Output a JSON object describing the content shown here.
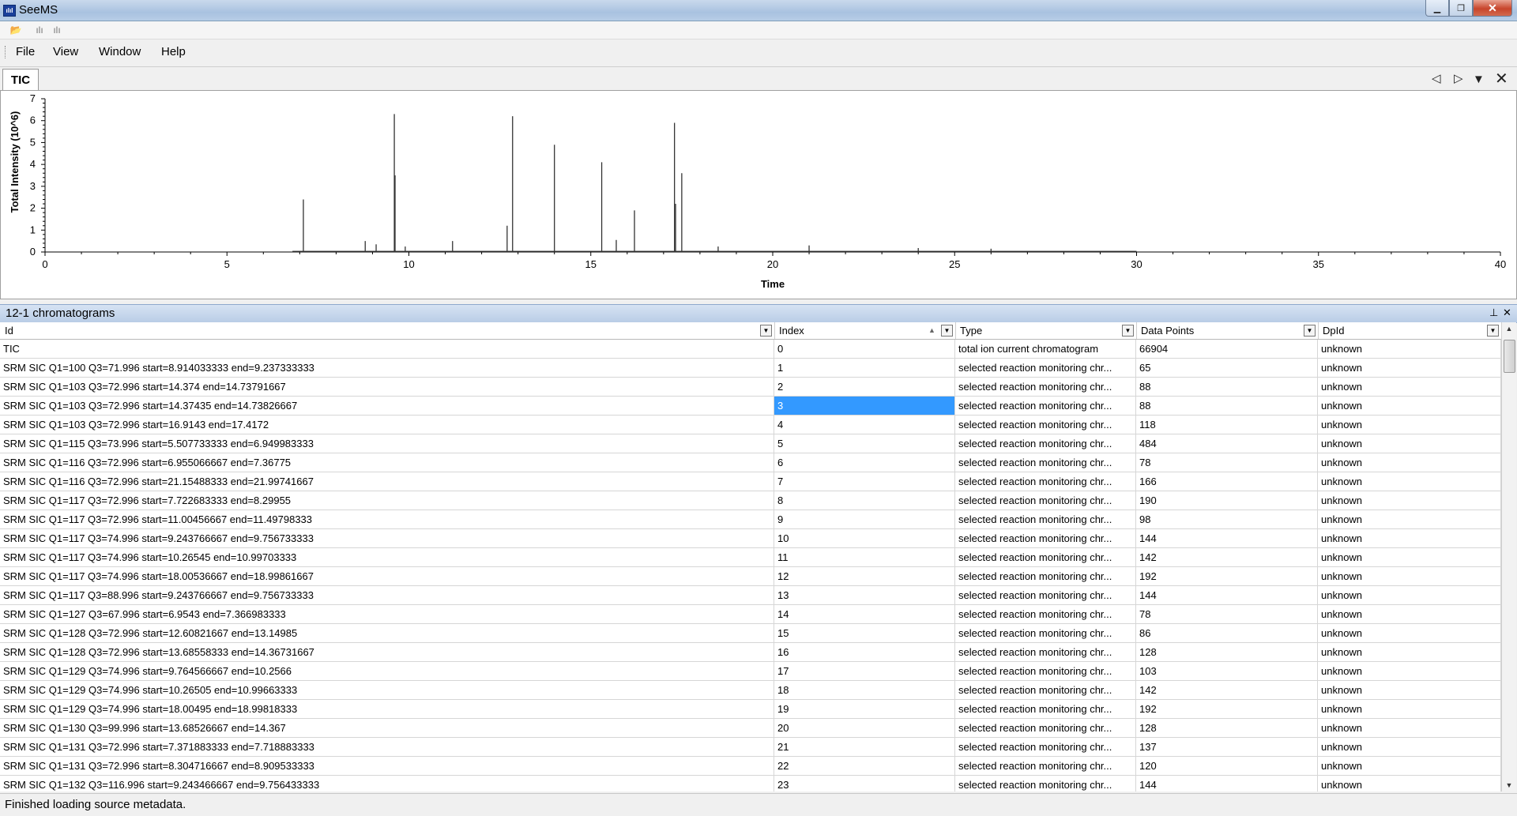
{
  "window": {
    "title": "SeeMS",
    "app_icon": "seems-app-icon"
  },
  "menu": [
    "File",
    "View",
    "Window",
    "Help"
  ],
  "tab": {
    "label": "TIC"
  },
  "chart_data": {
    "type": "line",
    "xlabel": "Time",
    "ylabel": "Total Intensity (10^6)",
    "xlim": [
      0,
      40
    ],
    "ylim": [
      0,
      7
    ],
    "x_ticks": [
      "0",
      "5",
      "10",
      "15",
      "20",
      "25",
      "30",
      "35",
      "40"
    ],
    "y_ticks": [
      "0",
      "1",
      "2",
      "3",
      "4",
      "5",
      "6",
      "7"
    ],
    "peaks": [
      {
        "x": 7.1,
        "y": 2.4
      },
      {
        "x": 8.8,
        "y": 0.5
      },
      {
        "x": 9.1,
        "y": 0.35
      },
      {
        "x": 9.6,
        "y": 6.3
      },
      {
        "x": 9.62,
        "y": 3.5
      },
      {
        "x": 9.9,
        "y": 0.25
      },
      {
        "x": 11.2,
        "y": 0.5
      },
      {
        "x": 12.7,
        "y": 1.2
      },
      {
        "x": 12.85,
        "y": 6.2
      },
      {
        "x": 14.0,
        "y": 4.9
      },
      {
        "x": 15.3,
        "y": 4.1
      },
      {
        "x": 15.7,
        "y": 0.55
      },
      {
        "x": 16.2,
        "y": 1.9
      },
      {
        "x": 17.3,
        "y": 5.9
      },
      {
        "x": 17.33,
        "y": 2.2
      },
      {
        "x": 17.5,
        "y": 3.6
      },
      {
        "x": 18.5,
        "y": 0.25
      },
      {
        "x": 21.0,
        "y": 0.3
      },
      {
        "x": 24.0,
        "y": 0.18
      },
      {
        "x": 26.0,
        "y": 0.15
      }
    ]
  },
  "grid": {
    "caption": "12-1 chromatograms",
    "columns": [
      "Id",
      "Index",
      "Type",
      "Data Points",
      "DpId"
    ],
    "rows": [
      [
        "TIC",
        "0",
        "total ion current chromatogram",
        "66904",
        "unknown"
      ],
      [
        "SRM SIC Q1=100 Q3=71.996 start=8.914033333 end=9.237333333",
        "1",
        "selected reaction monitoring chr...",
        "65",
        "unknown"
      ],
      [
        "SRM SIC Q1=103 Q3=72.996 start=14.374 end=14.73791667",
        "2",
        "selected reaction monitoring chr...",
        "88",
        "unknown"
      ],
      [
        "SRM SIC Q1=103 Q3=72.996 start=14.37435 end=14.73826667",
        "3",
        "selected reaction monitoring chr...",
        "88",
        "unknown"
      ],
      [
        "SRM SIC Q1=103 Q3=72.996 start=16.9143 end=17.4172",
        "4",
        "selected reaction monitoring chr...",
        "118",
        "unknown"
      ],
      [
        "SRM SIC Q1=115 Q3=73.996 start=5.507733333 end=6.949983333",
        "5",
        "selected reaction monitoring chr...",
        "484",
        "unknown"
      ],
      [
        "SRM SIC Q1=116 Q3=72.996 start=6.955066667 end=7.36775",
        "6",
        "selected reaction monitoring chr...",
        "78",
        "unknown"
      ],
      [
        "SRM SIC Q1=116 Q3=72.996 start=21.15488333 end=21.99741667",
        "7",
        "selected reaction monitoring chr...",
        "166",
        "unknown"
      ],
      [
        "SRM SIC Q1=117 Q3=72.996 start=7.722683333 end=8.29955",
        "8",
        "selected reaction monitoring chr...",
        "190",
        "unknown"
      ],
      [
        "SRM SIC Q1=117 Q3=72.996 start=11.00456667 end=11.49798333",
        "9",
        "selected reaction monitoring chr...",
        "98",
        "unknown"
      ],
      [
        "SRM SIC Q1=117 Q3=74.996 start=9.243766667 end=9.756733333",
        "10",
        "selected reaction monitoring chr...",
        "144",
        "unknown"
      ],
      [
        "SRM SIC Q1=117 Q3=74.996 start=10.26545 end=10.99703333",
        "11",
        "selected reaction monitoring chr...",
        "142",
        "unknown"
      ],
      [
        "SRM SIC Q1=117 Q3=74.996 start=18.00536667 end=18.99861667",
        "12",
        "selected reaction monitoring chr...",
        "192",
        "unknown"
      ],
      [
        "SRM SIC Q1=117 Q3=88.996 start=9.243766667 end=9.756733333",
        "13",
        "selected reaction monitoring chr...",
        "144",
        "unknown"
      ],
      [
        "SRM SIC Q1=127 Q3=67.996 start=6.9543 end=7.366983333",
        "14",
        "selected reaction monitoring chr...",
        "78",
        "unknown"
      ],
      [
        "SRM SIC Q1=128 Q3=72.996 start=12.60821667 end=13.14985",
        "15",
        "selected reaction monitoring chr...",
        "86",
        "unknown"
      ],
      [
        "SRM SIC Q1=128 Q3=72.996 start=13.68558333 end=14.36731667",
        "16",
        "selected reaction monitoring chr...",
        "128",
        "unknown"
      ],
      [
        "SRM SIC Q1=129 Q3=74.996 start=9.764566667 end=10.2566",
        "17",
        "selected reaction monitoring chr...",
        "103",
        "unknown"
      ],
      [
        "SRM SIC Q1=129 Q3=74.996 start=10.26505 end=10.99663333",
        "18",
        "selected reaction monitoring chr...",
        "142",
        "unknown"
      ],
      [
        "SRM SIC Q1=129 Q3=74.996 start=18.00495 end=18.99818333",
        "19",
        "selected reaction monitoring chr...",
        "192",
        "unknown"
      ],
      [
        "SRM SIC Q1=130 Q3=99.996 start=13.68526667 end=14.367",
        "20",
        "selected reaction monitoring chr...",
        "128",
        "unknown"
      ],
      [
        "SRM SIC Q1=131 Q3=72.996 start=7.371883333 end=7.718883333",
        "21",
        "selected reaction monitoring chr...",
        "137",
        "unknown"
      ],
      [
        "SRM SIC Q1=131 Q3=72.996 start=8.304716667 end=8.909533333",
        "22",
        "selected reaction monitoring chr...",
        "120",
        "unknown"
      ],
      [
        "SRM SIC Q1=132 Q3=116.996 start=9.243466667 end=9.756433333",
        "23",
        "selected reaction monitoring chr...",
        "144",
        "unknown"
      ]
    ],
    "selected_cell": {
      "row": 3,
      "col": 1
    }
  },
  "status": "Finished loading source metadata.",
  "colors": {
    "selection": "#3399ff",
    "header": "#b9cde6"
  }
}
